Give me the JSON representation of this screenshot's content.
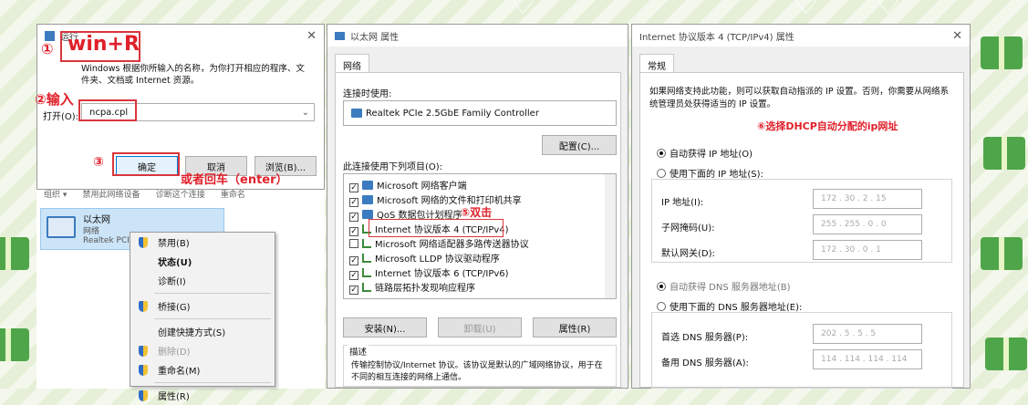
{
  "run_dialog": {
    "title": "运行",
    "description": "Windows 根据你所输入的名称，为你打开相应的程序、文件夹、文档或 Internet 资源。",
    "open_label": "打开(O):",
    "open_value": "ncpa.cpl",
    "ok_label": "确定",
    "cancel_label": "取消",
    "browse_label": "浏览(B)..."
  },
  "explorer": {
    "toolbar_text": "组织 ▾      禁用此网络设备      诊断这个连接      重命名",
    "adapter_name": "以太网",
    "adapter_status": "网络",
    "adapter_device": "Realtek PCIe"
  },
  "context_menu": {
    "items": [
      "禁用(B)",
      "状态(U)",
      "诊断(I)",
      "桥接(G)",
      "创建快捷方式(S)",
      "删除(D)",
      "重命名(M)",
      "属性(R)"
    ]
  },
  "eth_props": {
    "title": "以太网 属性",
    "tab": "网络",
    "connect_using_label": "连接时使用:",
    "adapter": "Realtek PCIe 2.5GbE Family Controller",
    "configure_label": "配置(C)...",
    "items_label": "此连接使用下列项目(O):",
    "items": [
      "Microsoft 网络客户端",
      "Microsoft 网络的文件和打印机共享",
      "QoS 数据包计划程序",
      "Internet 协议版本 4 (TCP/IPv4)",
      "Microsoft 网络适配器多路传送器协议",
      "Microsoft LLDP 协议驱动程序",
      "Internet 协议版本 6 (TCP/IPv6)",
      "链路层拓扑发现响应程序"
    ],
    "install_label": "安装(N)...",
    "uninstall_label": "卸载(U)",
    "properties_label": "属性(R)",
    "desc_title": "描述",
    "desc_text": "传输控制协议/Internet 协议。该协议是默认的广域网络协议，用于在不同的相互连接的网络上通信。"
  },
  "ipv4_props": {
    "title": "Internet 协议版本 4 (TCP/IPv4) 属性",
    "tab": "常规",
    "intro": "如果网络支持此功能，则可以获取自动指派的 IP 设置。否则，你需要从网络系统管理员处获得适当的 IP 设置。",
    "auto_ip": "自动获得 IP 地址(O)",
    "manual_ip": "使用下面的 IP 地址(S):",
    "ip_label": "IP 地址(I):",
    "subnet_label": "子网掩码(U):",
    "gateway_label": "默认网关(D):",
    "ip_value": "172 . 30 . 2 . 15",
    "subnet_value": "255 . 255 . 0 . 0",
    "gateway_value": "172 . 30 . 0 . 1",
    "auto_dns": "自动获得 DNS 服务器地址(B)",
    "manual_dns": "使用下面的 DNS 服务器地址(E):",
    "pref_dns_label": "首选 DNS 服务器(P):",
    "alt_dns_label": "备用 DNS 服务器(A):",
    "pref_dns_value": "202 . 5 . 5 . 5",
    "alt_dns_value": "114 . 114 . 114 . 114"
  },
  "annotations": {
    "step1": "①",
    "winr": "win+R",
    "step2": "②输入",
    "step3": "③",
    "enter_hint": "或者回车（enter）",
    "step5": "⑤双击",
    "step6": "⑥选择DHCP自动分配的ip网址"
  },
  "colors": {
    "accent_red": "#e0202a",
    "bg_green": "#4fa64a"
  }
}
